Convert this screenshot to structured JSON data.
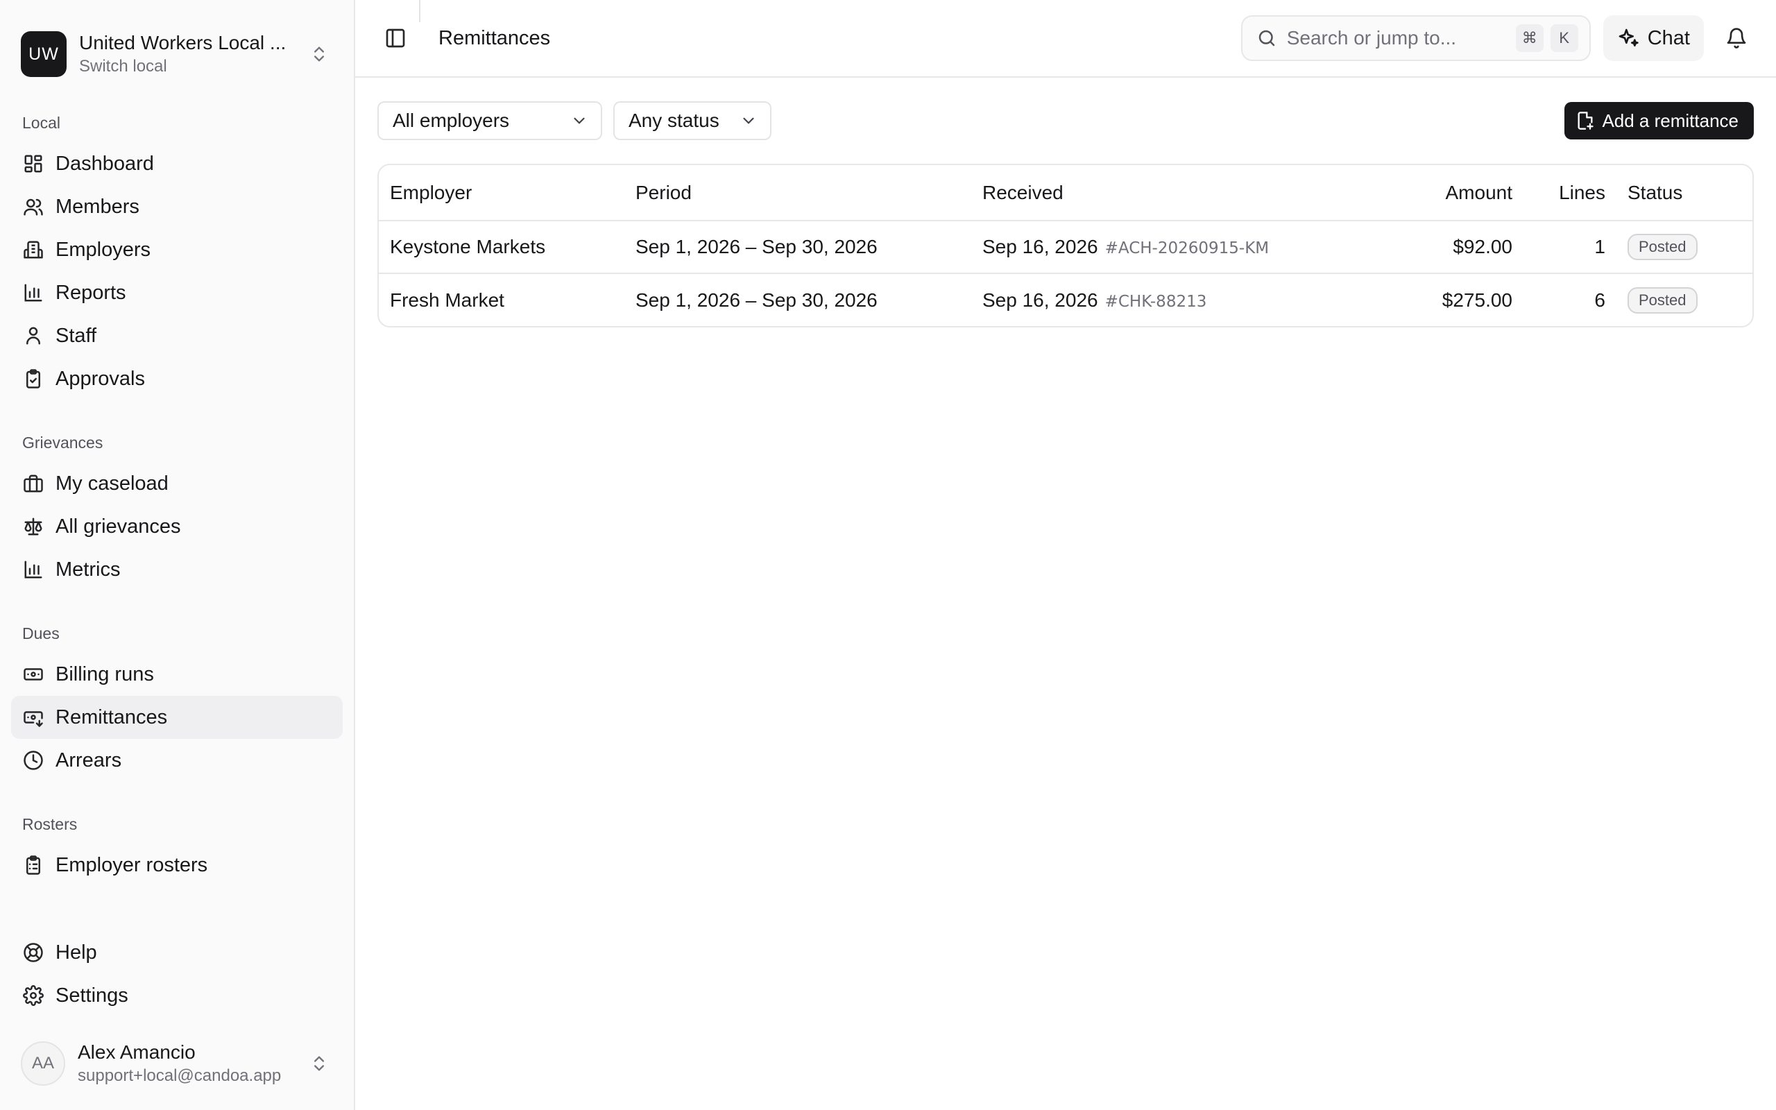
{
  "org": {
    "initials": "UW",
    "name": "United Workers Local ...",
    "sub": "Switch local"
  },
  "sidebar": {
    "sections": [
      {
        "label": "Local",
        "items": [
          {
            "label": "Dashboard",
            "icon": "dashboard-icon"
          },
          {
            "label": "Members",
            "icon": "users-icon"
          },
          {
            "label": "Employers",
            "icon": "building-icon"
          },
          {
            "label": "Reports",
            "icon": "bar-chart-icon"
          },
          {
            "label": "Staff",
            "icon": "user-icon"
          },
          {
            "label": "Approvals",
            "icon": "clipboard-check-icon"
          }
        ]
      },
      {
        "label": "Grievances",
        "items": [
          {
            "label": "My caseload",
            "icon": "briefcase-icon"
          },
          {
            "label": "All grievances",
            "icon": "scale-icon"
          },
          {
            "label": "Metrics",
            "icon": "bar-chart-icon"
          }
        ]
      },
      {
        "label": "Dues",
        "items": [
          {
            "label": "Billing runs",
            "icon": "banknote-icon"
          },
          {
            "label": "Remittances",
            "icon": "banknote-arrow-icon",
            "active": true
          },
          {
            "label": "Arrears",
            "icon": "clock-icon"
          }
        ]
      },
      {
        "label": "Rosters",
        "items": [
          {
            "label": "Employer rosters",
            "icon": "clipboard-list-icon"
          }
        ]
      }
    ],
    "help": "Help",
    "settings": "Settings"
  },
  "user": {
    "initials": "AA",
    "name": "Alex Amancio",
    "email": "support+local@candoa.app"
  },
  "topbar": {
    "title": "Remittances",
    "search_placeholder": "Search or jump to...",
    "kbd_mod": "⌘",
    "kbd_key": "K",
    "chat_label": "Chat"
  },
  "filters": {
    "employer": "All employers",
    "status": "Any status",
    "add_label": "Add a remittance"
  },
  "table": {
    "headers": {
      "employer": "Employer",
      "period": "Period",
      "received": "Received",
      "amount": "Amount",
      "lines": "Lines",
      "status": "Status"
    },
    "rows": [
      {
        "employer": "Keystone Markets",
        "period": "Sep 1, 2026 – Sep 30, 2026",
        "received": "Sep 16, 2026",
        "ref": "#ACH-20260915-KM",
        "amount": "$92.00",
        "lines": "1",
        "status": "Posted"
      },
      {
        "employer": "Fresh Market",
        "period": "Sep 1, 2026 – Sep 30, 2026",
        "received": "Sep 16, 2026",
        "ref": "#CHK-88213",
        "amount": "$275.00",
        "lines": "6",
        "status": "Posted"
      }
    ]
  }
}
